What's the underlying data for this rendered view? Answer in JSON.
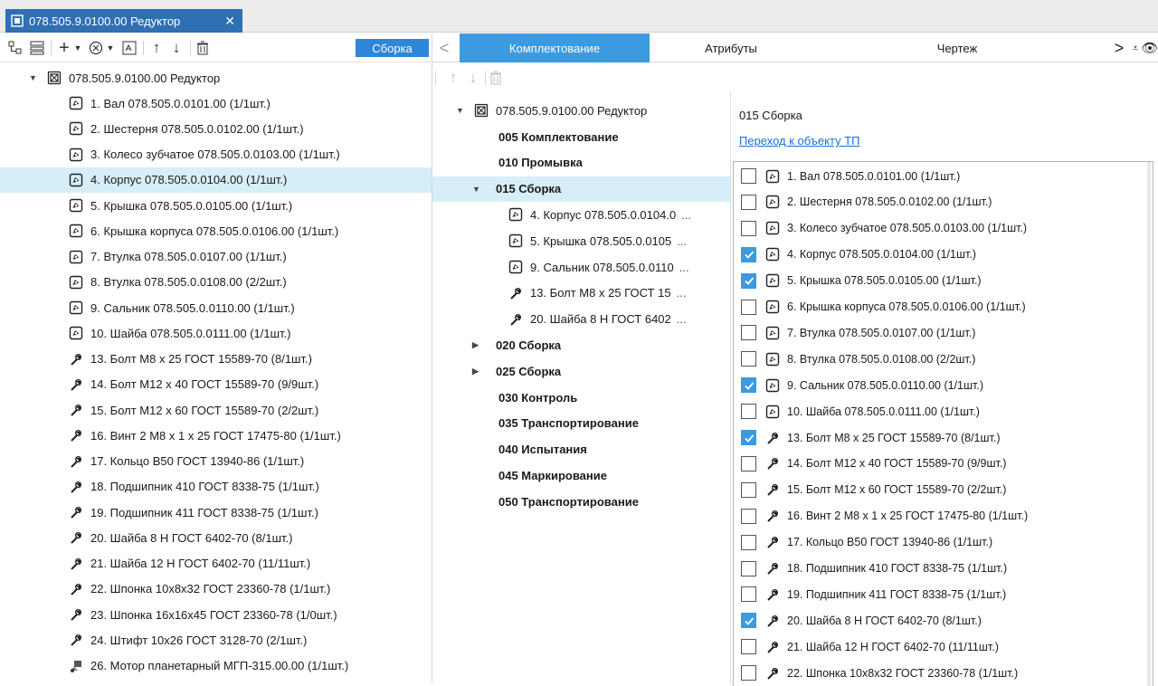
{
  "window": {
    "tab_title": "078.505.9.0100.00 Редуктор",
    "close_glyph": "✕"
  },
  "left_toolbar": {
    "assembly_button": "Сборка"
  },
  "left_tree": {
    "root": "078.505.9.0100.00 Редуктор",
    "items": [
      {
        "label": "1. Вал 078.505.0.0101.00 (1/1шт.)",
        "icon": "part-icon"
      },
      {
        "label": "2. Шестерня 078.505.0.0102.00 (1/1шт.)",
        "icon": "part-icon"
      },
      {
        "label": "3. Колесо зубчатое 078.505.0.0103.00 (1/1шт.)",
        "icon": "part-icon"
      },
      {
        "label": "4. Корпус 078.505.0.0104.00 (1/1шт.)",
        "icon": "part-icon",
        "selected": true
      },
      {
        "label": "5. Крышка 078.505.0.0105.00 (1/1шт.)",
        "icon": "part-icon"
      },
      {
        "label": "6. Крышка корпуса 078.505.0.0106.00 (1/1шт.)",
        "icon": "part-icon"
      },
      {
        "label": "7. Втулка 078.505.0.0107.00 (1/1шт.)",
        "icon": "part-icon"
      },
      {
        "label": "8. Втулка 078.505.0.0108.00 (2/2шт.)",
        "icon": "part-icon"
      },
      {
        "label": "9. Сальник 078.505.0.0110.00 (1/1шт.)",
        "icon": "part-icon"
      },
      {
        "label": "10. Шайба 078.505.0.0111.00 (1/1шт.)",
        "icon": "part-icon"
      },
      {
        "label": "13. Болт М8 x 25 ГОСТ 15589-70 (8/1шт.)",
        "icon": "standard-part-icon"
      },
      {
        "label": "14. Болт М12 x 40 ГОСТ 15589-70 (9/9шт.)",
        "icon": "standard-part-icon"
      },
      {
        "label": "15. Болт М12 x 60 ГОСТ 15589-70 (2/2шт.)",
        "icon": "standard-part-icon"
      },
      {
        "label": "16. Винт 2 М8 x 1 x 25 ГОСТ 17475-80 (1/1шт.)",
        "icon": "standard-part-icon"
      },
      {
        "label": "17. Кольцо В50 ГОСТ 13940-86 (1/1шт.)",
        "icon": "standard-part-icon"
      },
      {
        "label": "18. Подшипник 410 ГОСТ 8338-75 (1/1шт.)",
        "icon": "standard-part-icon"
      },
      {
        "label": "19. Подшипник 411 ГОСТ 8338-75 (1/1шт.)",
        "icon": "standard-part-icon"
      },
      {
        "label": "20. Шайба 8 Н ГОСТ 6402-70 (8/1шт.)",
        "icon": "standard-part-icon"
      },
      {
        "label": "21. Шайба 12 Н ГОСТ 6402-70 (11/11шт.)",
        "icon": "standard-part-icon"
      },
      {
        "label": "22. Шпонка 10x8x32 ГОСТ 23360-78 (1/1шт.)",
        "icon": "standard-part-icon"
      },
      {
        "label": "23. Шпонка 16x16x45 ГОСТ 23360-78 (1/0шт.)",
        "icon": "standard-part-icon"
      },
      {
        "label": "24. Штифт 10x26 ГОСТ 3128-70 (2/1шт.)",
        "icon": "standard-part-icon"
      },
      {
        "label": "26. Мотор планетарный МГП-315.00.00 (1/1шт.)",
        "icon": "purchased-part-icon"
      }
    ]
  },
  "right_tabs": [
    {
      "label": "Комплектование",
      "active": true
    },
    {
      "label": "Атрибуты",
      "active": false
    },
    {
      "label": "Чертеж",
      "active": false
    }
  ],
  "process_tree": {
    "root": "078.505.9.0100.00 Редуктор",
    "ops": [
      {
        "label": "005 Комплектование"
      },
      {
        "label": "010 Промывка"
      },
      {
        "label": "015 Сборка",
        "expanded": true,
        "selected": true,
        "children": [
          {
            "label": "4. Корпус 078.505.0.0104.0",
            "icon": "part-icon"
          },
          {
            "label": "5. Крышка 078.505.0.0105",
            "icon": "part-icon"
          },
          {
            "label": "9. Сальник 078.505.0.0110",
            "icon": "part-icon"
          },
          {
            "label": "13. Болт М8 x 25 ГОСТ 15",
            "icon": "standard-part-icon"
          },
          {
            "label": "20. Шайба 8 Н ГОСТ 6402",
            "icon": "standard-part-icon"
          }
        ]
      },
      {
        "label": "020 Сборка",
        "collapsed": true
      },
      {
        "label": "025 Сборка",
        "collapsed": true
      },
      {
        "label": "030 Контроль"
      },
      {
        "label": "035 Транспортирование"
      },
      {
        "label": "040 Испытания"
      },
      {
        "label": "045 Маркирование"
      },
      {
        "label": "050 Транспортирование"
      }
    ],
    "more_glyph": "..."
  },
  "detail": {
    "title": "015 Сборка",
    "link": "Переход к объекту ТП",
    "items": [
      {
        "label": "1. Вал 078.505.0.0101.00 (1/1шт.)",
        "icon": "part-icon",
        "checked": false
      },
      {
        "label": "2. Шестерня 078.505.0.0102.00 (1/1шт.)",
        "icon": "part-icon",
        "checked": false
      },
      {
        "label": "3. Колесо зубчатое 078.505.0.0103.00 (1/1шт.)",
        "icon": "part-icon",
        "checked": false
      },
      {
        "label": "4. Корпус 078.505.0.0104.00 (1/1шт.)",
        "icon": "part-icon",
        "checked": true
      },
      {
        "label": "5. Крышка 078.505.0.0105.00 (1/1шт.)",
        "icon": "part-icon",
        "checked": true
      },
      {
        "label": "6. Крышка корпуса 078.505.0.0106.00 (1/1шт.)",
        "icon": "part-icon",
        "checked": false
      },
      {
        "label": "7. Втулка 078.505.0.0107.00 (1/1шт.)",
        "icon": "part-icon",
        "checked": false
      },
      {
        "label": "8. Втулка 078.505.0.0108.00 (2/2шт.)",
        "icon": "part-icon",
        "checked": false
      },
      {
        "label": "9. Сальник 078.505.0.0110.00 (1/1шт.)",
        "icon": "part-icon",
        "checked": true
      },
      {
        "label": "10. Шайба 078.505.0.0111.00 (1/1шт.)",
        "icon": "part-icon",
        "checked": false
      },
      {
        "label": "13. Болт М8 x 25 ГОСТ 15589-70 (8/1шт.)",
        "icon": "standard-part-icon",
        "checked": true
      },
      {
        "label": "14. Болт М12 x 40 ГОСТ 15589-70 (9/9шт.)",
        "icon": "standard-part-icon",
        "checked": false
      },
      {
        "label": "15. Болт М12 x 60 ГОСТ 15589-70 (2/2шт.)",
        "icon": "standard-part-icon",
        "checked": false
      },
      {
        "label": "16. Винт 2 М8 x 1 x 25 ГОСТ 17475-80 (1/1шт.)",
        "icon": "standard-part-icon",
        "checked": false
      },
      {
        "label": "17. Кольцо В50 ГОСТ 13940-86 (1/1шт.)",
        "icon": "standard-part-icon",
        "checked": false
      },
      {
        "label": "18. Подшипник 410 ГОСТ 8338-75 (1/1шт.)",
        "icon": "standard-part-icon",
        "checked": false
      },
      {
        "label": "19. Подшипник 411 ГОСТ 8338-75 (1/1шт.)",
        "icon": "standard-part-icon",
        "checked": false
      },
      {
        "label": "20. Шайба 8 Н ГОСТ 6402-70 (8/1шт.)",
        "icon": "standard-part-icon",
        "checked": true
      },
      {
        "label": "21. Шайба 12 Н ГОСТ 6402-70 (11/11шт.)",
        "icon": "standard-part-icon",
        "checked": false
      },
      {
        "label": "22. Шпонка 10x8x32 ГОСТ 23360-78 (1/1шт.)",
        "icon": "standard-part-icon",
        "checked": false
      }
    ]
  },
  "colors": {
    "accent": "#3c9ae0",
    "tab_blue": "#2f6fb3",
    "selection": "#d6eef8",
    "link": "#1a6ed8"
  }
}
